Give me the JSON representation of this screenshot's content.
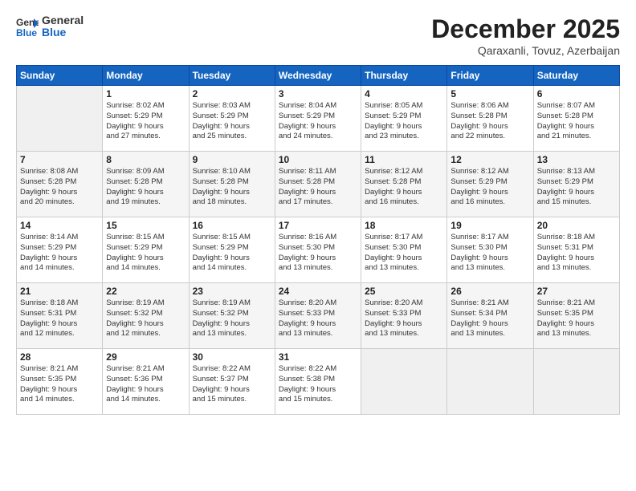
{
  "logo": {
    "line1": "General",
    "line2": "Blue"
  },
  "title": "December 2025",
  "subtitle": "Qaraxanli, Tovuz, Azerbaijan",
  "days_header": [
    "Sunday",
    "Monday",
    "Tuesday",
    "Wednesday",
    "Thursday",
    "Friday",
    "Saturday"
  ],
  "weeks": [
    [
      {
        "num": "",
        "info": ""
      },
      {
        "num": "1",
        "info": "Sunrise: 8:02 AM\nSunset: 5:29 PM\nDaylight: 9 hours\nand 27 minutes."
      },
      {
        "num": "2",
        "info": "Sunrise: 8:03 AM\nSunset: 5:29 PM\nDaylight: 9 hours\nand 25 minutes."
      },
      {
        "num": "3",
        "info": "Sunrise: 8:04 AM\nSunset: 5:29 PM\nDaylight: 9 hours\nand 24 minutes."
      },
      {
        "num": "4",
        "info": "Sunrise: 8:05 AM\nSunset: 5:29 PM\nDaylight: 9 hours\nand 23 minutes."
      },
      {
        "num": "5",
        "info": "Sunrise: 8:06 AM\nSunset: 5:28 PM\nDaylight: 9 hours\nand 22 minutes."
      },
      {
        "num": "6",
        "info": "Sunrise: 8:07 AM\nSunset: 5:28 PM\nDaylight: 9 hours\nand 21 minutes."
      }
    ],
    [
      {
        "num": "7",
        "info": "Sunrise: 8:08 AM\nSunset: 5:28 PM\nDaylight: 9 hours\nand 20 minutes."
      },
      {
        "num": "8",
        "info": "Sunrise: 8:09 AM\nSunset: 5:28 PM\nDaylight: 9 hours\nand 19 minutes."
      },
      {
        "num": "9",
        "info": "Sunrise: 8:10 AM\nSunset: 5:28 PM\nDaylight: 9 hours\nand 18 minutes."
      },
      {
        "num": "10",
        "info": "Sunrise: 8:11 AM\nSunset: 5:28 PM\nDaylight: 9 hours\nand 17 minutes."
      },
      {
        "num": "11",
        "info": "Sunrise: 8:12 AM\nSunset: 5:28 PM\nDaylight: 9 hours\nand 16 minutes."
      },
      {
        "num": "12",
        "info": "Sunrise: 8:12 AM\nSunset: 5:29 PM\nDaylight: 9 hours\nand 16 minutes."
      },
      {
        "num": "13",
        "info": "Sunrise: 8:13 AM\nSunset: 5:29 PM\nDaylight: 9 hours\nand 15 minutes."
      }
    ],
    [
      {
        "num": "14",
        "info": "Sunrise: 8:14 AM\nSunset: 5:29 PM\nDaylight: 9 hours\nand 14 minutes."
      },
      {
        "num": "15",
        "info": "Sunrise: 8:15 AM\nSunset: 5:29 PM\nDaylight: 9 hours\nand 14 minutes."
      },
      {
        "num": "16",
        "info": "Sunrise: 8:15 AM\nSunset: 5:29 PM\nDaylight: 9 hours\nand 14 minutes."
      },
      {
        "num": "17",
        "info": "Sunrise: 8:16 AM\nSunset: 5:30 PM\nDaylight: 9 hours\nand 13 minutes."
      },
      {
        "num": "18",
        "info": "Sunrise: 8:17 AM\nSunset: 5:30 PM\nDaylight: 9 hours\nand 13 minutes."
      },
      {
        "num": "19",
        "info": "Sunrise: 8:17 AM\nSunset: 5:30 PM\nDaylight: 9 hours\nand 13 minutes."
      },
      {
        "num": "20",
        "info": "Sunrise: 8:18 AM\nSunset: 5:31 PM\nDaylight: 9 hours\nand 13 minutes."
      }
    ],
    [
      {
        "num": "21",
        "info": "Sunrise: 8:18 AM\nSunset: 5:31 PM\nDaylight: 9 hours\nand 12 minutes."
      },
      {
        "num": "22",
        "info": "Sunrise: 8:19 AM\nSunset: 5:32 PM\nDaylight: 9 hours\nand 12 minutes."
      },
      {
        "num": "23",
        "info": "Sunrise: 8:19 AM\nSunset: 5:32 PM\nDaylight: 9 hours\nand 13 minutes."
      },
      {
        "num": "24",
        "info": "Sunrise: 8:20 AM\nSunset: 5:33 PM\nDaylight: 9 hours\nand 13 minutes."
      },
      {
        "num": "25",
        "info": "Sunrise: 8:20 AM\nSunset: 5:33 PM\nDaylight: 9 hours\nand 13 minutes."
      },
      {
        "num": "26",
        "info": "Sunrise: 8:21 AM\nSunset: 5:34 PM\nDaylight: 9 hours\nand 13 minutes."
      },
      {
        "num": "27",
        "info": "Sunrise: 8:21 AM\nSunset: 5:35 PM\nDaylight: 9 hours\nand 13 minutes."
      }
    ],
    [
      {
        "num": "28",
        "info": "Sunrise: 8:21 AM\nSunset: 5:35 PM\nDaylight: 9 hours\nand 14 minutes."
      },
      {
        "num": "29",
        "info": "Sunrise: 8:21 AM\nSunset: 5:36 PM\nDaylight: 9 hours\nand 14 minutes."
      },
      {
        "num": "30",
        "info": "Sunrise: 8:22 AM\nSunset: 5:37 PM\nDaylight: 9 hours\nand 15 minutes."
      },
      {
        "num": "31",
        "info": "Sunrise: 8:22 AM\nSunset: 5:38 PM\nDaylight: 9 hours\nand 15 minutes."
      },
      {
        "num": "",
        "info": ""
      },
      {
        "num": "",
        "info": ""
      },
      {
        "num": "",
        "info": ""
      }
    ]
  ]
}
